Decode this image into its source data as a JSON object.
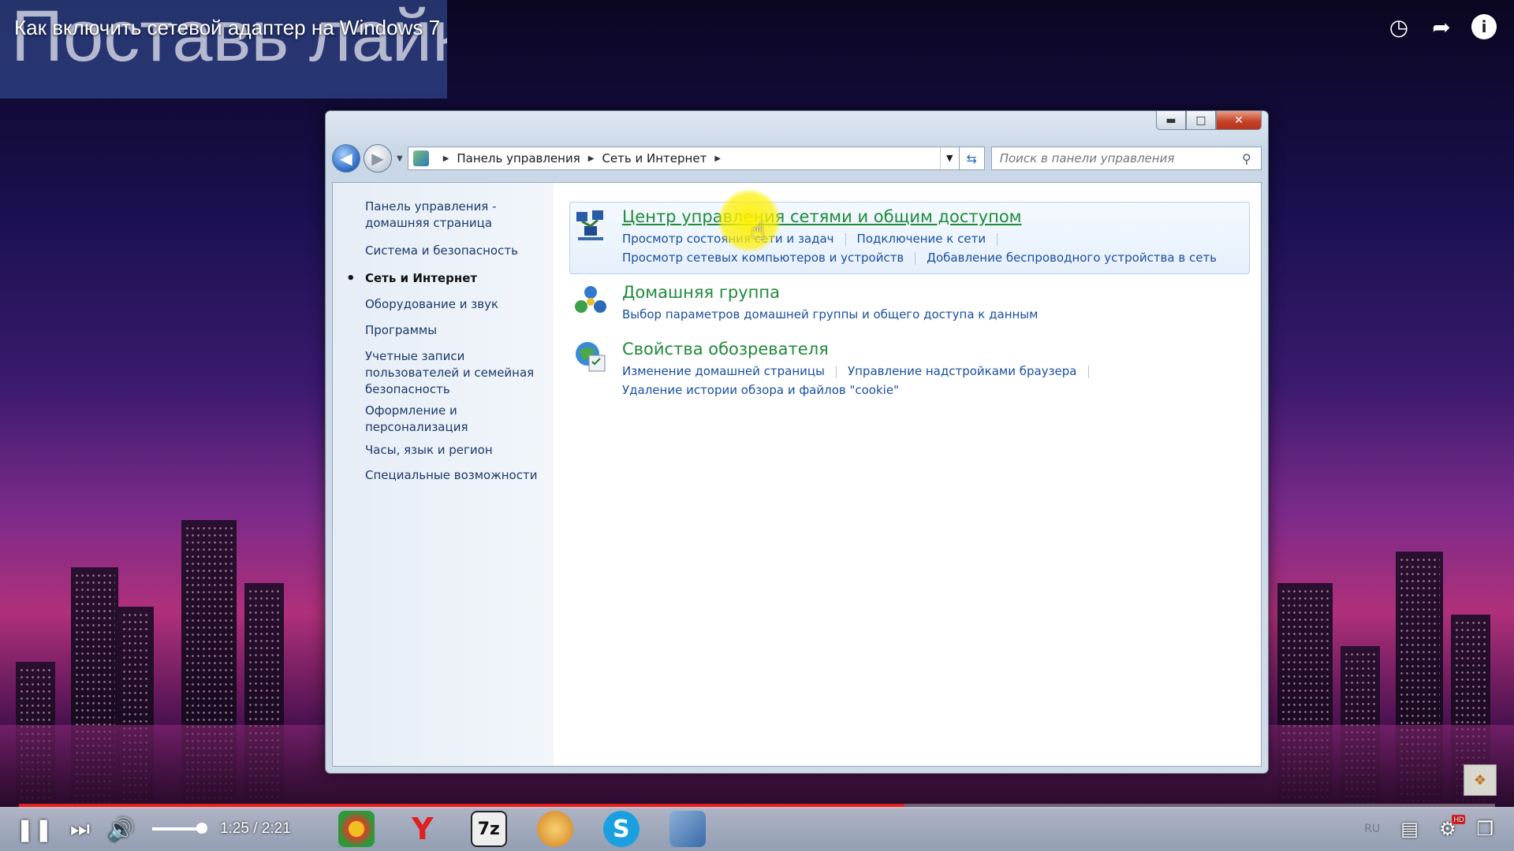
{
  "video": {
    "overlay_text": "Поставь лайк",
    "title": "Как включить сетевой адаптер на Windows 7",
    "current_time": "1:25",
    "duration": "2:21",
    "time_display": "1:25 / 2:21",
    "progress": 0.6,
    "volume": 0.8,
    "hd_badge": "HD"
  },
  "window": {
    "breadcrumb": [
      "Панель управления",
      "Сеть и Интернет"
    ],
    "search_placeholder": "Поиск в панели управления",
    "sidebar": [
      {
        "label": "Панель управления - домашняя страница",
        "active": false
      },
      {
        "label": "Система и безопасность",
        "active": false
      },
      {
        "label": "Сеть и Интернет",
        "active": true
      },
      {
        "label": "Оборудование и звук",
        "active": false
      },
      {
        "label": "Программы",
        "active": false
      },
      {
        "label": "Учетные записи пользователей и семейная безопасность",
        "active": false
      },
      {
        "label": "Оформление и персонализация",
        "active": false
      },
      {
        "label": "Часы, язык и регион",
        "active": false
      },
      {
        "label": "Специальные возможности",
        "active": false
      }
    ],
    "categories": [
      {
        "title": "Центр управления сетями и общим доступом",
        "links": [
          [
            "Просмотр состояния сети и задач",
            "Подключение к сети"
          ],
          [
            "Просмотр сетевых компьютеров и устройств",
            "Добавление беспроводного устройства в сеть"
          ]
        ]
      },
      {
        "title": "Домашняя группа",
        "links": [
          [
            "Выбор параметров домашней группы и общего доступа к данным"
          ]
        ]
      },
      {
        "title": "Свойства обозревателя",
        "links": [
          [
            "Изменение домашней страницы",
            "Управление надстройками браузера"
          ],
          [
            "Удаление истории обзора и файлов \"cookie\""
          ]
        ]
      }
    ]
  },
  "taskbar": {
    "lang": "RU",
    "apps": [
      "chrome-icon",
      "yandex-icon",
      "7zip-icon",
      "media-icon",
      "skype-icon",
      "control-panel-icon"
    ],
    "app_labels": {
      "yandex": "Y",
      "sevenzip": "7z",
      "skype": "S"
    }
  },
  "colors": {
    "progress": "#e22020",
    "link": "#1a4fa0",
    "category_title": "#1f8a3a"
  }
}
